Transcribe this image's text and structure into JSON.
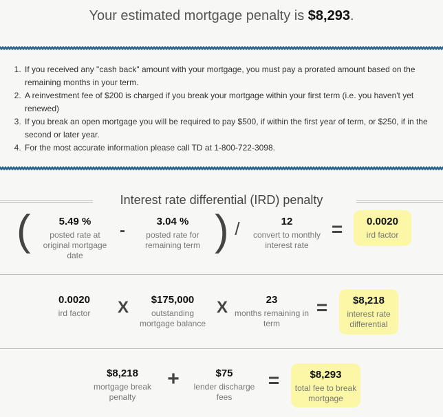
{
  "headline": {
    "prefix": "Your estimated mortgage penalty is ",
    "amount": "$8,293",
    "suffix": "."
  },
  "notes": [
    "If you received any \"cash back\" amount with your mortgage, you must pay a prorated amount based on the remaining months in your term.",
    "A reinvestment fee of $200 is charged if you break your mortgage within your first term (i.e. you haven't yet renewed)",
    "If you break an open mortgage you will be required to pay $500, if within the first year of term, or $250, if in the second or later year.",
    "For the most accurate information please call TD at 1-800-722-3098."
  ],
  "ird_section": {
    "title": "Interest rate differential (IRD) penalty",
    "row1": {
      "open_paren": "(",
      "close_paren": ")",
      "op_minus": "-",
      "op_divide": "/",
      "op_equals": "=",
      "posted_rate_original": {
        "value": "5.49 %",
        "label": "posted rate at original mortgage date"
      },
      "posted_rate_remaining": {
        "value": "3.04 %",
        "label": "posted rate for remaining term"
      },
      "months_divisor": {
        "value": "12",
        "label": "convert to monthly interest rate"
      },
      "ird_factor": {
        "value": "0.0020",
        "label": "ird factor"
      }
    },
    "row2": {
      "op_times_1": "X",
      "op_times_2": "X",
      "op_equals": "=",
      "ird_factor": {
        "value": "0.0020",
        "label": "ird factor"
      },
      "balance": {
        "value": "$175,000",
        "label": "outstanding mortgage balance"
      },
      "months_remaining": {
        "value": "23",
        "label": "months remaining in term"
      },
      "ird": {
        "value": "$8,218",
        "label": "interest rate differential"
      }
    },
    "row3": {
      "op_plus": "+",
      "op_equals": "=",
      "break_penalty": {
        "value": "$8,218",
        "label": "mortgage break penalty"
      },
      "discharge_fees": {
        "value": "$75",
        "label": "lender discharge fees"
      },
      "total_fee": {
        "value": "$8,293",
        "label": "total fee to break mortgage"
      }
    }
  },
  "colors": {
    "accent_wave": "#2f6690",
    "result_highlight": "#fbf7a6"
  }
}
